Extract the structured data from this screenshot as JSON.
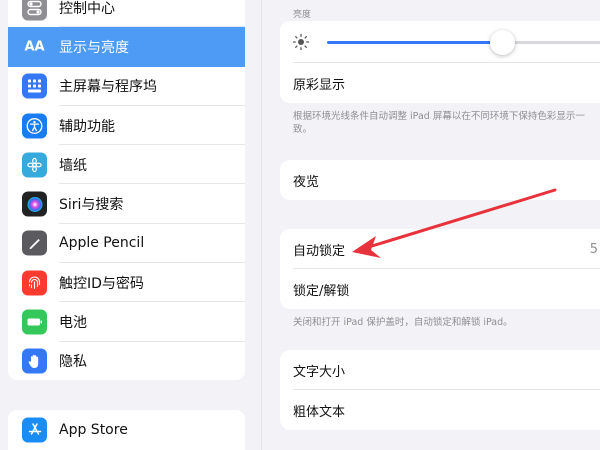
{
  "sidebar": {
    "items": [
      {
        "label": "控制中心",
        "icon": "control-center-icon",
        "color": "#8e8e93"
      },
      {
        "label": "显示与亮度",
        "icon": "text-size-icon",
        "color": "#3478f6",
        "active": true
      },
      {
        "label": "主屏幕与程序坞",
        "icon": "home-screen-icon",
        "color": "#3478f6"
      },
      {
        "label": "辅助功能",
        "icon": "accessibility-icon",
        "color": "#1a7cf5"
      },
      {
        "label": "墙纸",
        "icon": "wallpaper-icon",
        "color": "#36aadc"
      },
      {
        "label": "Siri与搜索",
        "icon": "siri-icon",
        "color": "#222222"
      },
      {
        "label": "Apple Pencil",
        "icon": "pencil-icon",
        "color": "#5a5a5f"
      },
      {
        "label": "触控ID与密码",
        "icon": "fingerprint-icon",
        "color": "#ff3b30"
      },
      {
        "label": "电池",
        "icon": "battery-icon",
        "color": "#34c759"
      },
      {
        "label": "隐私",
        "icon": "hand-icon",
        "color": "#3478f6"
      }
    ],
    "items2": [
      {
        "label": "App Store",
        "icon": "app-store-icon",
        "color": "#1a8cf5"
      }
    ]
  },
  "detail": {
    "brightness_header": "亮度",
    "brightness_level": 0.62,
    "true_tone_label": "原彩显示",
    "true_tone_footer": "根据环境光线条件自动调整 iPad 屏幕以在不同环境下保持色彩显示一致。",
    "night_shift_label": "夜览",
    "auto_lock_label": "自动锁定",
    "auto_lock_value": "5",
    "lock_unlock_label": "锁定/解锁",
    "lock_footer": "关闭和打开 iPad 保护盖时，自动锁定和解锁 iPad。",
    "text_size_label": "文字大小",
    "bold_text_label": "粗体文本"
  },
  "colors": {
    "accent": "#3478f6",
    "selection": "#4e9bf5",
    "annotation_arrow": "#e8323c"
  }
}
